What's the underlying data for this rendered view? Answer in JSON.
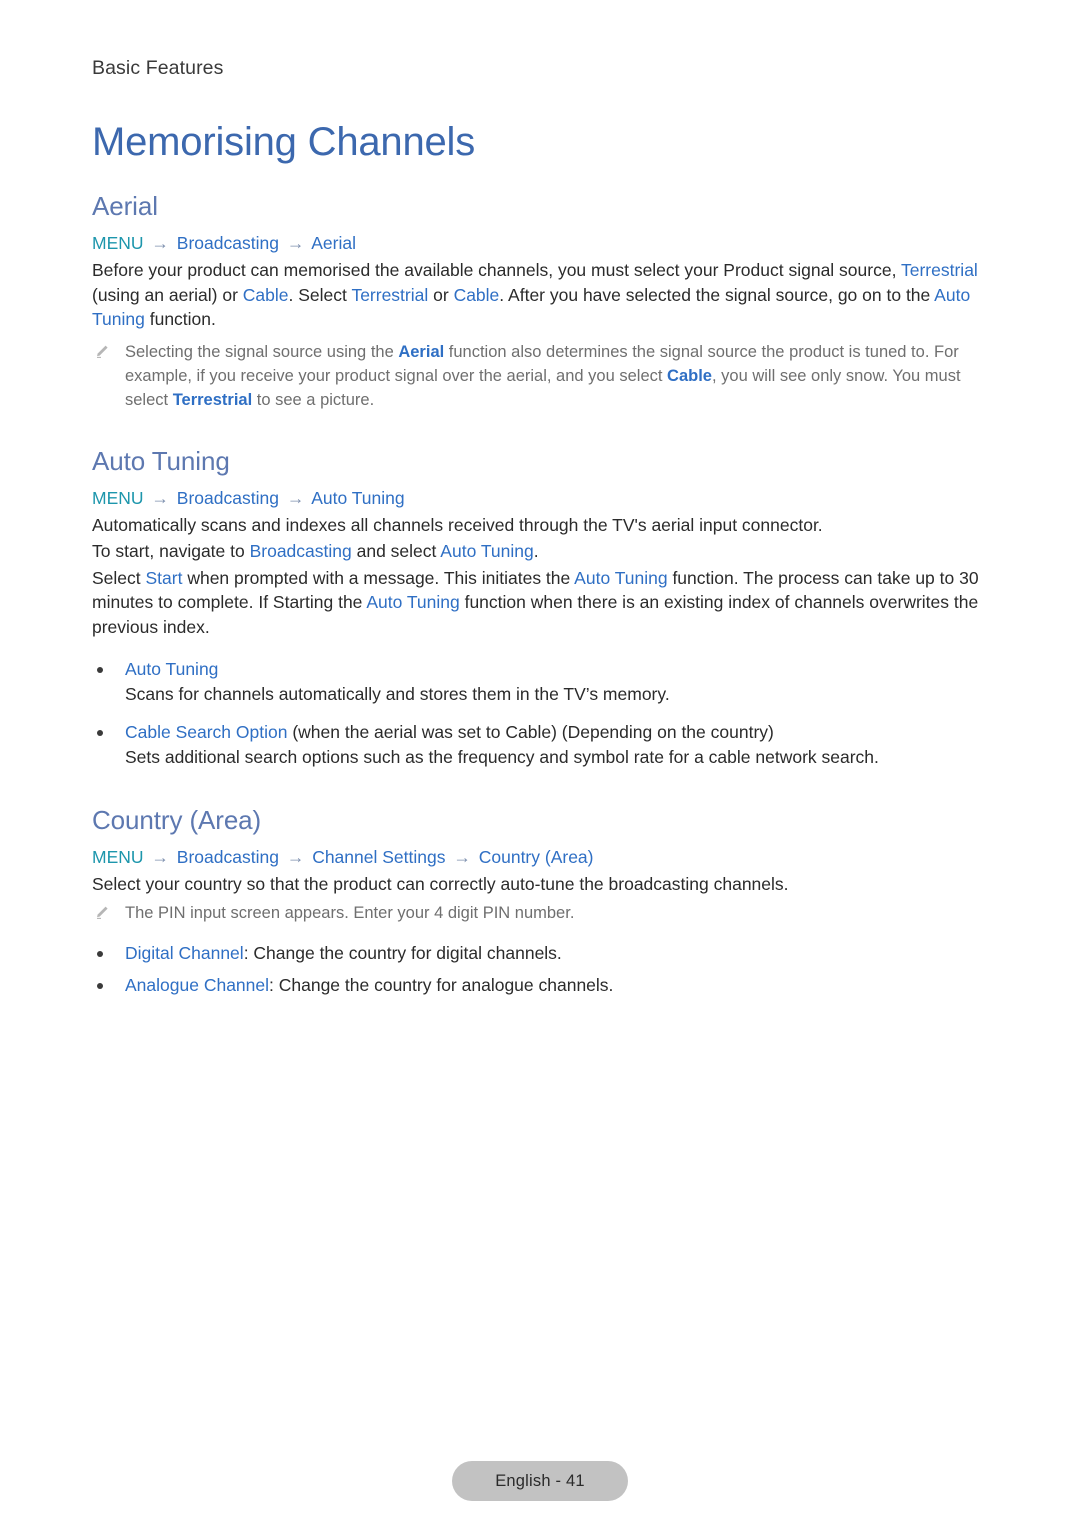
{
  "header": {
    "running_head": "Basic Features"
  },
  "doc": {
    "title": "Memorising Channels"
  },
  "colors": {
    "title_blue": "#3c68ae",
    "section_blue": "#5d78b0",
    "term_blue": "#2f6fc4",
    "menu_teal": "#1d96ac",
    "note_grey": "#6f6f6f",
    "footer_pill": "#c2c2c2"
  },
  "sections": [
    {
      "title": "Aerial",
      "breadcrumb": {
        "menu": "MENU",
        "arrow": "→",
        "items": [
          "Broadcasting",
          "Aerial"
        ]
      },
      "paragraph": {
        "p1_a": "Before your product can memorised the available channels, you must select your Product signal source, ",
        "t1": "Terrestrial",
        "p1_b": " (using an aerial) or ",
        "t2": "Cable",
        "p1_c": ". Select ",
        "t3": "Terrestrial",
        "p1_d": " or ",
        "t4": "Cable",
        "p1_e": ". After you have selected the signal source, go on to the ",
        "t5": "Auto Tuning",
        "p1_f": " function."
      },
      "note": {
        "n_a": "Selecting the signal source using the ",
        "t1": "Aerial",
        "n_b": " function also determines the signal source the product is tuned to. For example, if you receive your product signal over the aerial, and you select ",
        "t2": "Cable",
        "n_c": ", you will see only snow. You must select ",
        "t3": "Terrestrial",
        "n_d": " to see a picture."
      }
    },
    {
      "title": "Auto Tuning",
      "breadcrumb": {
        "menu": "MENU",
        "arrow": "→",
        "items": [
          "Broadcasting",
          "Auto Tuning"
        ]
      },
      "paragraphs": {
        "p1": "Automatically scans and indexes all channels received through the TV's aerial input connector.",
        "p2_a": "To start, navigate to ",
        "p2_t1": "Broadcasting",
        "p2_b": " and select ",
        "p2_t2": "Auto Tuning",
        "p2_c": ".",
        "p3_a": "Select ",
        "p3_t1": "Start",
        "p3_b": " when prompted with a message. This initiates the ",
        "p3_t2": "Auto Tuning",
        "p3_c": " function. The process can take up to 30 minutes to complete. If Starting the ",
        "p3_t3": "Auto Tuning",
        "p3_d": " function when there is an existing index of channels overwrites the previous index."
      },
      "bullets": [
        {
          "term": "Auto Tuning",
          "rest": "",
          "desc": "Scans for channels automatically and stores them in the TV’s memory."
        },
        {
          "term": "Cable Search Option",
          "rest": " (when the aerial was set to Cable) (Depending on the country)",
          "desc": "Sets additional search options such as the frequency and symbol rate for a cable network search."
        }
      ]
    },
    {
      "title": "Country (Area)",
      "breadcrumb": {
        "menu": "MENU",
        "arrow": "→",
        "items": [
          "Broadcasting",
          "Channel Settings",
          "Country (Area)"
        ]
      },
      "paragraphs": {
        "p1": "Select your country so that the product can correctly auto-tune the broadcasting channels."
      },
      "note": {
        "text": "The PIN input screen appears. Enter your 4 digit PIN number."
      },
      "bullets": [
        {
          "term": "Digital Channel",
          "rest": ": Change the country for digital channels."
        },
        {
          "term": "Analogue Channel",
          "rest": ": Change the country for analogue channels."
        }
      ]
    }
  ],
  "footer": {
    "page_label": "English - 41"
  }
}
